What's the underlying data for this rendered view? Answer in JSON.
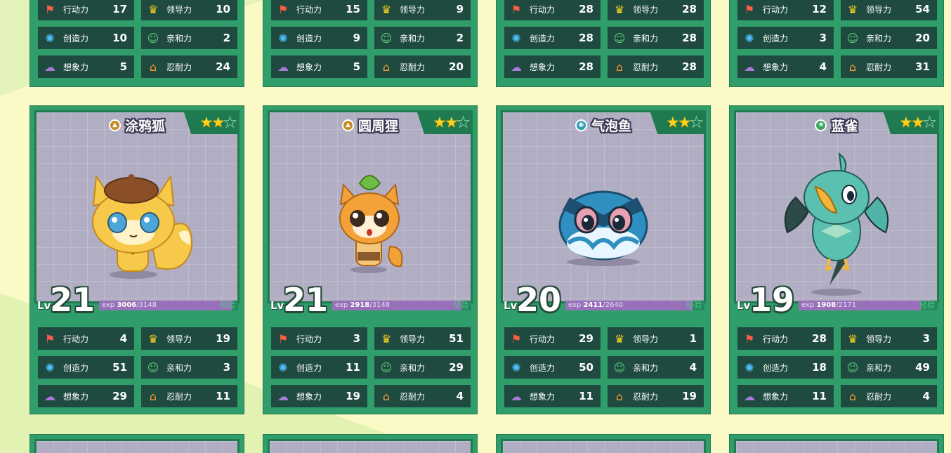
{
  "stat_labels": {
    "action": "行动力",
    "leadership": "领导力",
    "creativity": "创造力",
    "affinity": "亲和力",
    "imagination": "想象力",
    "endurance": "忍耐力"
  },
  "level_prefix": "Lv",
  "exp_prefix": "exp",
  "exp_tag": "经验",
  "top_row": [
    {
      "action": "17",
      "leadership": "10",
      "creativity": "10",
      "affinity": "2",
      "imagination": "5",
      "endurance": "24"
    },
    {
      "action": "15",
      "leadership": "9",
      "creativity": "9",
      "affinity": "2",
      "imagination": "5",
      "endurance": "20"
    },
    {
      "action": "28",
      "leadership": "28",
      "creativity": "28",
      "affinity": "28",
      "imagination": "28",
      "endurance": "28"
    },
    {
      "action": "12",
      "leadership": "54",
      "creativity": "3",
      "affinity": "20",
      "imagination": "4",
      "endurance": "31"
    }
  ],
  "cards": [
    {
      "name": "涂鸦狐",
      "type_icon": "ground-type-icon",
      "stars": 2,
      "level": "21",
      "exp_current": "3006",
      "exp_max": "/3148",
      "exp_fraction": 0.955,
      "action": "4",
      "leadership": "19",
      "creativity": "51",
      "affinity": "3",
      "imagination": "29",
      "endurance": "11"
    },
    {
      "name": "圆周狸",
      "type_icon": "ground-type-icon",
      "stars": 2,
      "level": "21",
      "exp_current": "2918",
      "exp_max": "/3148",
      "exp_fraction": 0.927,
      "action": "3",
      "leadership": "51",
      "creativity": "11",
      "affinity": "29",
      "imagination": "19",
      "endurance": "4"
    },
    {
      "name": "气泡鱼",
      "type_icon": "water-type-icon",
      "stars": 2,
      "level": "20",
      "exp_current": "2411",
      "exp_max": "/2640",
      "exp_fraction": 0.913,
      "action": "29",
      "leadership": "1",
      "creativity": "50",
      "affinity": "4",
      "imagination": "11",
      "endurance": "19"
    },
    {
      "name": "蓝雀",
      "type_icon": "grass-type-icon",
      "stars": 2,
      "level": "19",
      "exp_current": "1908",
      "exp_max": "/2171",
      "exp_fraction": 0.879,
      "action": "28",
      "leadership": "3",
      "creativity": "18",
      "affinity": "49",
      "imagination": "11",
      "endurance": "4"
    }
  ],
  "colors": {
    "card_green": "#2f9e6b",
    "stat_bg": "#1e4a40",
    "exp_purple": "#9770b9",
    "star_gold": "#ffd21e"
  }
}
